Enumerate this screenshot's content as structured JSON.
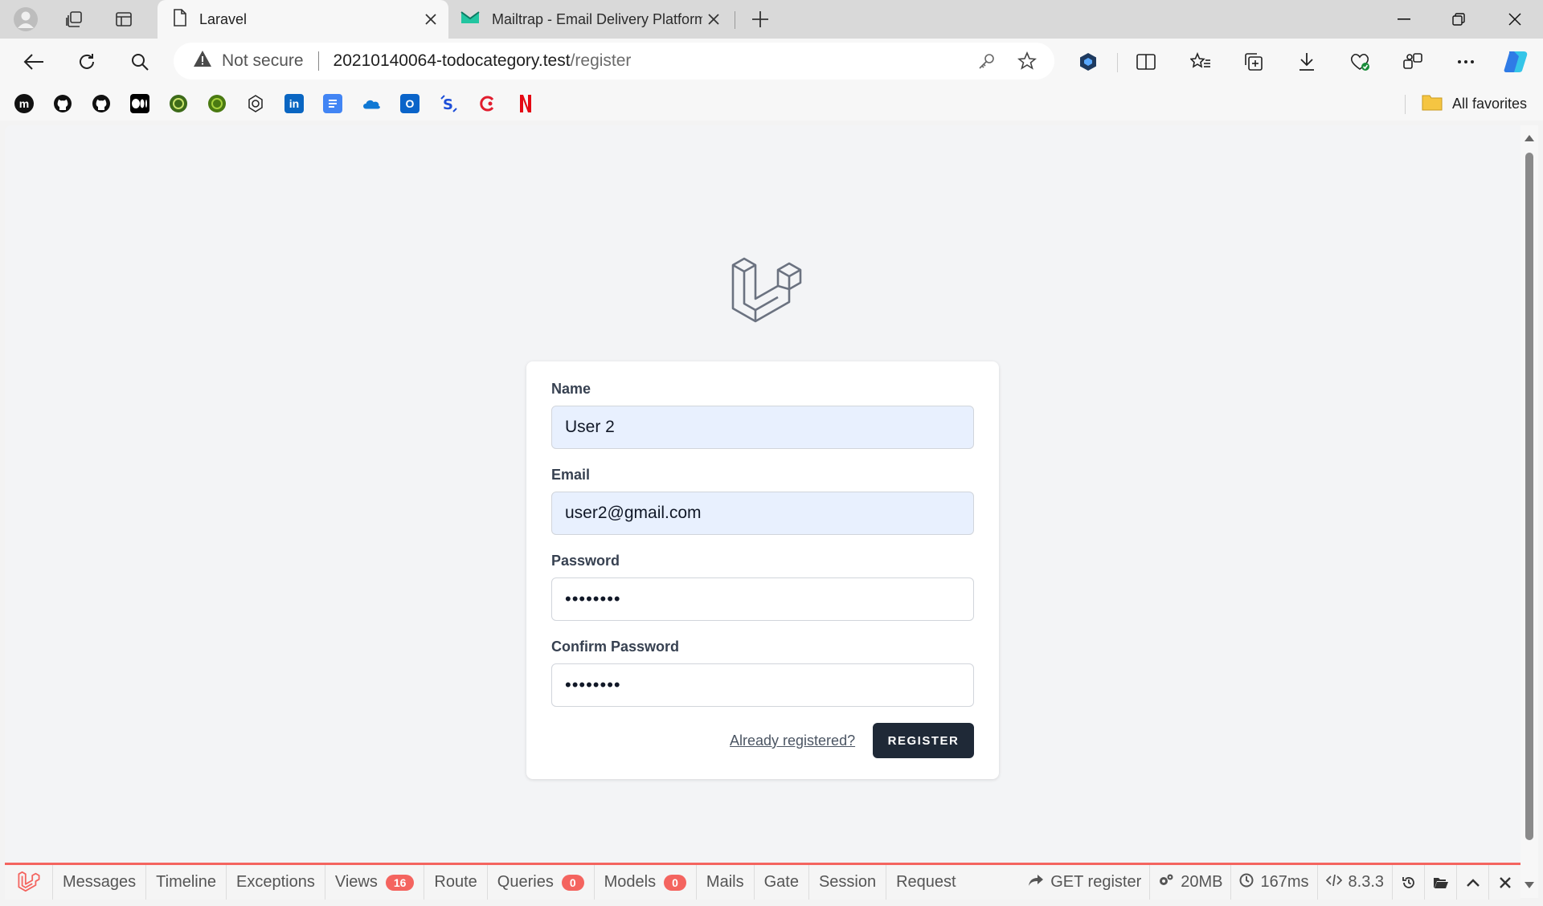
{
  "browser": {
    "tabs": [
      {
        "title": "Laravel",
        "active": true
      },
      {
        "title": "Mailtrap - Email Delivery Platform",
        "active": false
      }
    ],
    "address": {
      "security_label": "Not secure",
      "host": "20210140064-todocategory.test",
      "path": "/register"
    },
    "favorites": {
      "all_label": "All favorites",
      "items": [
        "medium-icon",
        "github-icon",
        "github-icon",
        "medium-icon",
        "circle-icon",
        "circle-icon",
        "chatgpt-icon",
        "linkedin-icon",
        "docs-icon",
        "onedrive-icon",
        "outlook-icon",
        "s-icon",
        "c-icon",
        "netflix-icon"
      ]
    }
  },
  "form": {
    "name_label": "Name",
    "name_value": "User 2",
    "email_label": "Email",
    "email_value": "user2@gmail.com",
    "password_label": "Password",
    "password_value": "••••••••",
    "confirm_label": "Confirm Password",
    "confirm_value": "••••••••",
    "login_link": "Already registered?",
    "submit_label": "REGISTER"
  },
  "debugbar": {
    "tabs": [
      {
        "label": "Messages"
      },
      {
        "label": "Timeline"
      },
      {
        "label": "Exceptions"
      },
      {
        "label": "Views",
        "badge": "16"
      },
      {
        "label": "Route"
      },
      {
        "label": "Queries",
        "badge": "0"
      },
      {
        "label": "Models",
        "badge": "0"
      },
      {
        "label": "Mails"
      },
      {
        "label": "Gate"
      },
      {
        "label": "Session"
      },
      {
        "label": "Request"
      }
    ],
    "request": "GET register",
    "memory": "20MB",
    "time": "167ms",
    "php_version": "8.3.3"
  },
  "colors": {
    "laravel_red": "#f4645f",
    "button_dark": "#1f2937",
    "autofill": "#e8f0fe"
  }
}
